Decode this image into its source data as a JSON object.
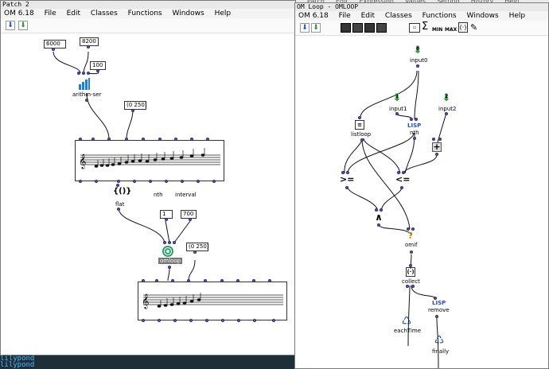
{
  "left_window": {
    "title": "Patch 2",
    "menus": [
      "OM 6.18",
      "File",
      "Edit",
      "Classes",
      "Functions",
      "Windows",
      "Help"
    ],
    "boxes": {
      "v6000": "6000",
      "v8200": "8200",
      "v100": "100",
      "range1": "(0 250)",
      "v1": "1",
      "v700": "700",
      "range2": "(0 250)"
    },
    "labels": {
      "arithm": "arithm-ser",
      "nth": "nth",
      "interval": "interval",
      "flat": "flat",
      "omloop": "omloop"
    }
  },
  "right_window": {
    "title": "OM Loop - OMLOOP",
    "menus": [
      "OM 6.18",
      "File",
      "Edit",
      "Classes",
      "Functions",
      "Windows",
      "Help"
    ],
    "toolbar_icons": [
      "min-icon",
      "sum-icon",
      "max-icon",
      "bracket-icon",
      "eraser-icon"
    ],
    "toolbar_text": {
      "sigma": "Σ",
      "min": "MIN",
      "max": "MAX"
    },
    "background_menu_text": [
      "Patch",
      "Edit",
      "Expression",
      "Values",
      "Setting",
      "History",
      "Help"
    ],
    "nodes": {
      "input0": "input0",
      "input0_num": "0",
      "input1": "input1",
      "input1_num": "1",
      "input2": "input2",
      "input2_num": "2",
      "listloop": "listloop",
      "nth": "nth",
      "lisp1": "LISP",
      "gte": ">=",
      "lte": "<=",
      "and": "∧",
      "omif": "omif",
      "collect": "collect",
      "lisp2": "LISP",
      "remove": "remove",
      "eachtime": "eachTime",
      "finally": "finally",
      "plus": "+",
      "q": "?"
    }
  },
  "taskbar": {
    "line1": "lilypond",
    "line2": "lilypond"
  }
}
